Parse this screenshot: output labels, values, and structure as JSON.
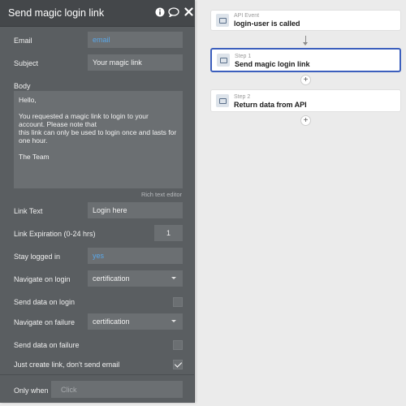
{
  "panel": {
    "title": "Send magic login link",
    "icons": [
      "info-icon",
      "comment-icon",
      "close-icon"
    ],
    "email": {
      "label": "Email",
      "value": "email"
    },
    "subject": {
      "label": "Subject",
      "value": "Your magic link"
    },
    "body": {
      "label": "Body",
      "lines": [
        "Hello,",
        "",
        "You requested a magic link to login to your",
        "account. Please note that",
        "this link can only be used to login once and lasts for",
        "one hour.",
        "",
        "The Team"
      ],
      "editor_label": "Rich text editor"
    },
    "link_text": {
      "label": "Link Text",
      "value": "Login here"
    },
    "link_expiration": {
      "label": "Link Expiration (0-24 hrs)",
      "value": "1"
    },
    "stay_logged_in": {
      "label": "Stay logged in",
      "value": "yes"
    },
    "navigate_on_login": {
      "label": "Navigate on login",
      "value": "certification"
    },
    "send_data_on_login": {
      "label": "Send data on login",
      "checked": false
    },
    "navigate_on_failure": {
      "label": "Navigate on failure",
      "value": "certification"
    },
    "send_data_on_failure": {
      "label": "Send data on failure",
      "checked": false
    },
    "just_create_link": {
      "label": "Just create link, don't send email",
      "checked": true
    },
    "only_when": {
      "label": "Only when",
      "placeholder": "Click"
    }
  },
  "workflow": {
    "event": {
      "type": "API Event",
      "name": "login-user is called"
    },
    "steps": [
      {
        "step": "Step 1",
        "name": "Send magic login link",
        "active": true
      },
      {
        "step": "Step 2",
        "name": "Return data from API",
        "active": false
      }
    ]
  }
}
